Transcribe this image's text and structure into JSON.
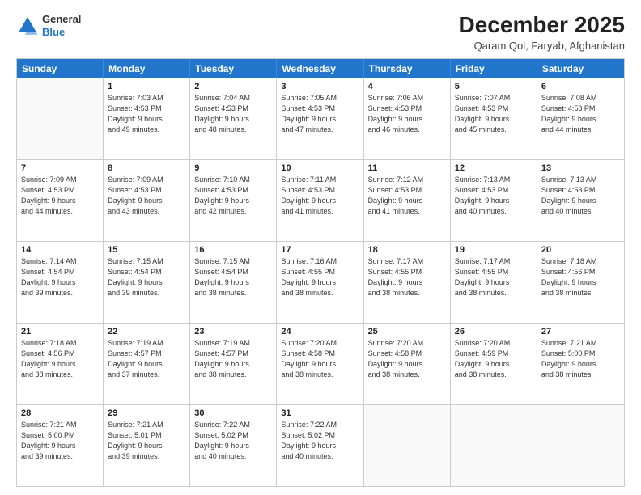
{
  "header": {
    "logo_general": "General",
    "logo_blue": "Blue",
    "month_year": "December 2025",
    "location": "Qaram Qol, Faryab, Afghanistan"
  },
  "days_of_week": [
    "Sunday",
    "Monday",
    "Tuesday",
    "Wednesday",
    "Thursday",
    "Friday",
    "Saturday"
  ],
  "weeks": [
    [
      {
        "day": "",
        "empty": true
      },
      {
        "day": "1",
        "sunrise": "7:03 AM",
        "sunset": "4:53 PM",
        "daylight": "9 hours and 49 minutes."
      },
      {
        "day": "2",
        "sunrise": "7:04 AM",
        "sunset": "4:53 PM",
        "daylight": "9 hours and 48 minutes."
      },
      {
        "day": "3",
        "sunrise": "7:05 AM",
        "sunset": "4:53 PM",
        "daylight": "9 hours and 47 minutes."
      },
      {
        "day": "4",
        "sunrise": "7:06 AM",
        "sunset": "4:53 PM",
        "daylight": "9 hours and 46 minutes."
      },
      {
        "day": "5",
        "sunrise": "7:07 AM",
        "sunset": "4:53 PM",
        "daylight": "9 hours and 45 minutes."
      },
      {
        "day": "6",
        "sunrise": "7:08 AM",
        "sunset": "4:53 PM",
        "daylight": "9 hours and 44 minutes."
      }
    ],
    [
      {
        "day": "7",
        "sunrise": "7:09 AM",
        "sunset": "4:53 PM",
        "daylight": "9 hours and 44 minutes."
      },
      {
        "day": "8",
        "sunrise": "7:09 AM",
        "sunset": "4:53 PM",
        "daylight": "9 hours and 43 minutes."
      },
      {
        "day": "9",
        "sunrise": "7:10 AM",
        "sunset": "4:53 PM",
        "daylight": "9 hours and 42 minutes."
      },
      {
        "day": "10",
        "sunrise": "7:11 AM",
        "sunset": "4:53 PM",
        "daylight": "9 hours and 41 minutes."
      },
      {
        "day": "11",
        "sunrise": "7:12 AM",
        "sunset": "4:53 PM",
        "daylight": "9 hours and 41 minutes."
      },
      {
        "day": "12",
        "sunrise": "7:13 AM",
        "sunset": "4:53 PM",
        "daylight": "9 hours and 40 minutes."
      },
      {
        "day": "13",
        "sunrise": "7:13 AM",
        "sunset": "4:53 PM",
        "daylight": "9 hours and 40 minutes."
      }
    ],
    [
      {
        "day": "14",
        "sunrise": "7:14 AM",
        "sunset": "4:54 PM",
        "daylight": "9 hours and 39 minutes."
      },
      {
        "day": "15",
        "sunrise": "7:15 AM",
        "sunset": "4:54 PM",
        "daylight": "9 hours and 39 minutes."
      },
      {
        "day": "16",
        "sunrise": "7:15 AM",
        "sunset": "4:54 PM",
        "daylight": "9 hours and 38 minutes."
      },
      {
        "day": "17",
        "sunrise": "7:16 AM",
        "sunset": "4:55 PM",
        "daylight": "9 hours and 38 minutes."
      },
      {
        "day": "18",
        "sunrise": "7:17 AM",
        "sunset": "4:55 PM",
        "daylight": "9 hours and 38 minutes."
      },
      {
        "day": "19",
        "sunrise": "7:17 AM",
        "sunset": "4:55 PM",
        "daylight": "9 hours and 38 minutes."
      },
      {
        "day": "20",
        "sunrise": "7:18 AM",
        "sunset": "4:56 PM",
        "daylight": "9 hours and 38 minutes."
      }
    ],
    [
      {
        "day": "21",
        "sunrise": "7:18 AM",
        "sunset": "4:56 PM",
        "daylight": "9 hours and 38 minutes."
      },
      {
        "day": "22",
        "sunrise": "7:19 AM",
        "sunset": "4:57 PM",
        "daylight": "9 hours and 37 minutes."
      },
      {
        "day": "23",
        "sunrise": "7:19 AM",
        "sunset": "4:57 PM",
        "daylight": "9 hours and 38 minutes."
      },
      {
        "day": "24",
        "sunrise": "7:20 AM",
        "sunset": "4:58 PM",
        "daylight": "9 hours and 38 minutes."
      },
      {
        "day": "25",
        "sunrise": "7:20 AM",
        "sunset": "4:58 PM",
        "daylight": "9 hours and 38 minutes."
      },
      {
        "day": "26",
        "sunrise": "7:20 AM",
        "sunset": "4:59 PM",
        "daylight": "9 hours and 38 minutes."
      },
      {
        "day": "27",
        "sunrise": "7:21 AM",
        "sunset": "5:00 PM",
        "daylight": "9 hours and 38 minutes."
      }
    ],
    [
      {
        "day": "28",
        "sunrise": "7:21 AM",
        "sunset": "5:00 PM",
        "daylight": "9 hours and 39 minutes."
      },
      {
        "day": "29",
        "sunrise": "7:21 AM",
        "sunset": "5:01 PM",
        "daylight": "9 hours and 39 minutes."
      },
      {
        "day": "30",
        "sunrise": "7:22 AM",
        "sunset": "5:02 PM",
        "daylight": "9 hours and 40 minutes."
      },
      {
        "day": "31",
        "sunrise": "7:22 AM",
        "sunset": "5:02 PM",
        "daylight": "9 hours and 40 minutes."
      },
      {
        "day": "",
        "empty": true
      },
      {
        "day": "",
        "empty": true
      },
      {
        "day": "",
        "empty": true
      }
    ]
  ]
}
